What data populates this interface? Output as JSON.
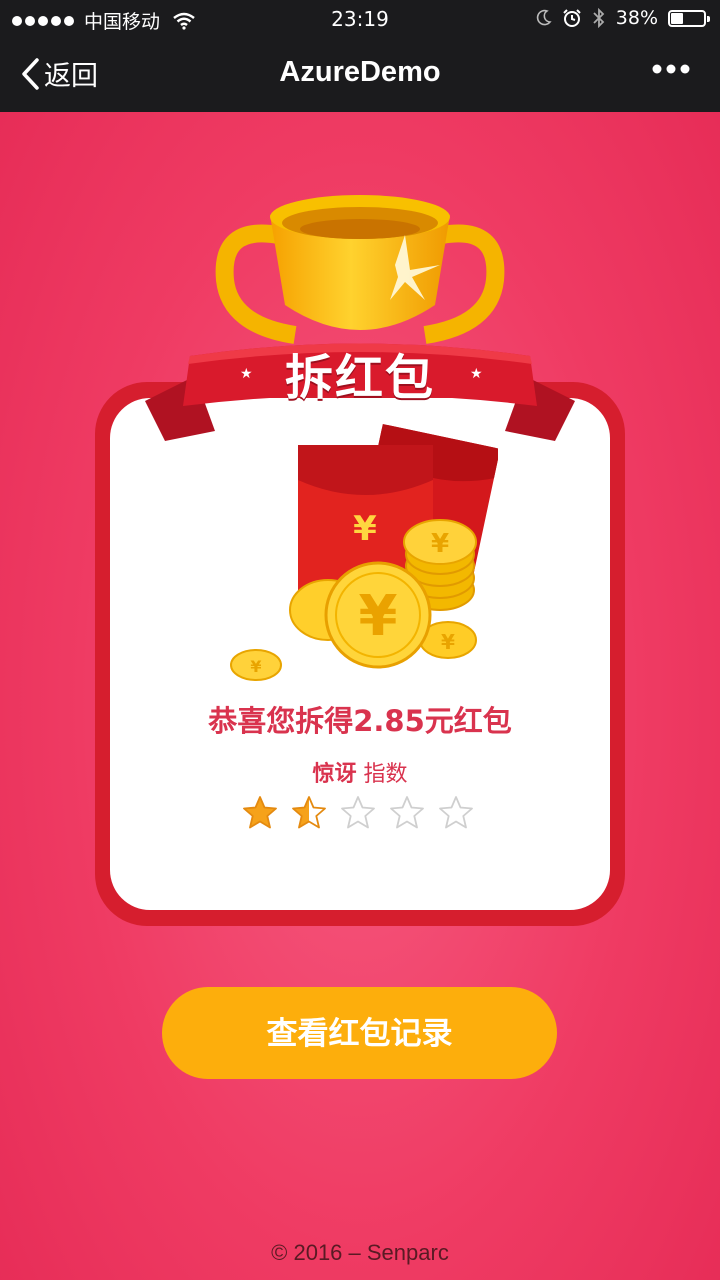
{
  "status_bar": {
    "carrier": "中国移动",
    "time": "23:19",
    "battery": "38%",
    "battery_level": 0.38
  },
  "nav": {
    "back_label": "返回",
    "title": "AzureDemo"
  },
  "card": {
    "ribbon_title": "拆红包",
    "congrats": "恭喜您拆得2.85元红包",
    "surprise_label_1": "惊讶",
    "surprise_label_2": "指数",
    "rating": 1.5,
    "rating_max": 5
  },
  "button": {
    "label": "查看红包记录"
  },
  "footer": {
    "copyright": "© 2016 – Senparc"
  },
  "colors": {
    "background": "#ef3b63",
    "card_border": "#d61e2e",
    "accent_text": "#d9334e",
    "button": "#fdae0c",
    "navbar": "#1b1b1d"
  }
}
